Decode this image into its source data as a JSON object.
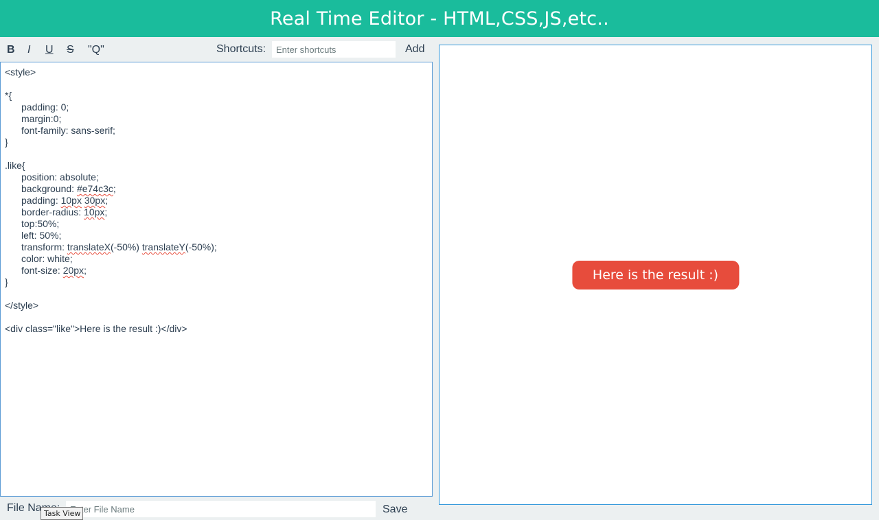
{
  "header": {
    "title": "Real Time Editor - HTML,CSS,JS,etc.."
  },
  "toolbar": {
    "bold_label": "B",
    "italic_label": "I",
    "underline_label": "U",
    "strike_label": "S",
    "quote_label": "\"Q\"",
    "shortcuts_label": "Shortcuts:",
    "shortcuts_placeholder": "Enter shortcuts",
    "add_label": "Add"
  },
  "editor": {
    "lines": [
      {
        "indent": false,
        "segments": [
          {
            "text": "<style>",
            "squiggle": false
          }
        ]
      },
      {
        "indent": false,
        "segments": []
      },
      {
        "indent": false,
        "segments": [
          {
            "text": "*{",
            "squiggle": false
          }
        ]
      },
      {
        "indent": true,
        "segments": [
          {
            "text": "padding: 0;",
            "squiggle": false
          }
        ]
      },
      {
        "indent": true,
        "segments": [
          {
            "text": "margin:0;",
            "squiggle": false
          }
        ]
      },
      {
        "indent": true,
        "segments": [
          {
            "text": "font-family: sans-serif;",
            "squiggle": false
          }
        ]
      },
      {
        "indent": false,
        "segments": [
          {
            "text": "}",
            "squiggle": false
          }
        ]
      },
      {
        "indent": false,
        "segments": []
      },
      {
        "indent": false,
        "segments": [
          {
            "text": ".like{",
            "squiggle": false
          }
        ]
      },
      {
        "indent": true,
        "segments": [
          {
            "text": "position: absolute;",
            "squiggle": false
          }
        ]
      },
      {
        "indent": true,
        "segments": [
          {
            "text": "background: ",
            "squiggle": false
          },
          {
            "text": "#e74c3c",
            "squiggle": true
          },
          {
            "text": ";",
            "squiggle": false
          }
        ]
      },
      {
        "indent": true,
        "segments": [
          {
            "text": "padding: ",
            "squiggle": false
          },
          {
            "text": "10px",
            "squiggle": true
          },
          {
            "text": " ",
            "squiggle": false
          },
          {
            "text": "30px",
            "squiggle": true
          },
          {
            "text": ";",
            "squiggle": false
          }
        ]
      },
      {
        "indent": true,
        "segments": [
          {
            "text": "border-radius: ",
            "squiggle": false
          },
          {
            "text": "10px",
            "squiggle": true
          },
          {
            "text": ";",
            "squiggle": false
          }
        ]
      },
      {
        "indent": true,
        "segments": [
          {
            "text": "top:50%;",
            "squiggle": false
          }
        ]
      },
      {
        "indent": true,
        "segments": [
          {
            "text": "left: 50%;",
            "squiggle": false
          }
        ]
      },
      {
        "indent": true,
        "segments": [
          {
            "text": "transform: ",
            "squiggle": false
          },
          {
            "text": "translateX",
            "squiggle": true
          },
          {
            "text": "(-50%) ",
            "squiggle": false
          },
          {
            "text": "translateY",
            "squiggle": true
          },
          {
            "text": "(-50%);",
            "squiggle": false
          }
        ]
      },
      {
        "indent": true,
        "segments": [
          {
            "text": "color: white;",
            "squiggle": false
          }
        ]
      },
      {
        "indent": true,
        "segments": [
          {
            "text": "font-size: ",
            "squiggle": false
          },
          {
            "text": "20px",
            "squiggle": true
          },
          {
            "text": ";",
            "squiggle": false
          }
        ]
      },
      {
        "indent": false,
        "segments": [
          {
            "text": "}",
            "squiggle": false
          }
        ]
      },
      {
        "indent": false,
        "segments": []
      },
      {
        "indent": false,
        "segments": [
          {
            "text": "</style>",
            "squiggle": false
          }
        ]
      },
      {
        "indent": false,
        "segments": []
      },
      {
        "indent": false,
        "segments": [
          {
            "text": "<div class=\"like\">Here is the result :)</div>",
            "squiggle": false
          }
        ]
      }
    ]
  },
  "preview": {
    "result_text": "Here is the result :)",
    "result_color": "#e74c3c"
  },
  "footer": {
    "file_name_label": "File Name:",
    "file_name_placeholder": "Enter File Name",
    "save_label": "Save"
  },
  "tooltip": {
    "text": "Task View"
  },
  "colors": {
    "header_bg": "#1abc9c",
    "page_bg": "#ecf0f1",
    "editor_border": "#5b9bd5",
    "preview_border": "#3498db",
    "spellcheck": "#e74c3c"
  }
}
